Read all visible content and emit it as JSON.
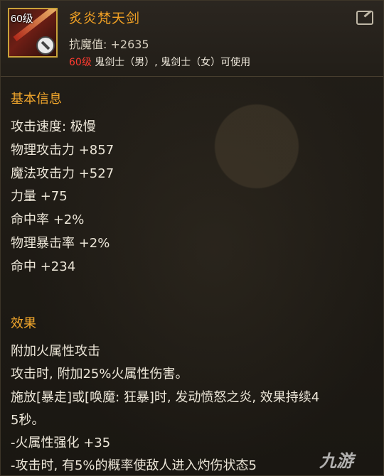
{
  "item": {
    "level_badge": "60级",
    "name": "炙炎梵天剑",
    "resist_label": "抗魔值: +2635",
    "usable_level": "60级",
    "usable_classes": "鬼剑士（男）, 鬼剑士（女）可使用"
  },
  "basic": {
    "title": "基本信息",
    "lines": [
      "攻击速度: 极慢",
      "物理攻击力 +857",
      "魔法攻击力 +527",
      "力量 +75",
      "命中率 +2%",
      "物理暴击率 +2%",
      "命中 +234"
    ]
  },
  "effect": {
    "title": "效果",
    "lines": [
      "附加火属性攻击",
      "攻击时, 附加25%火属性伤害。",
      "施放[暴走]或[唤魔: 狂暴]时, 发动愤怒之炎, 效果持续4",
      "5秒。",
      "-火属性强化 +35",
      "-攻击时, 有5%的概率使敌人进入灼伤状态5"
    ]
  },
  "watermark": "九游",
  "icons": {
    "share": "share-icon",
    "forbidden": "no-entry-icon"
  },
  "colors": {
    "name": "#f0a024",
    "section": "#f2a72c",
    "level_red": "#ff3b30"
  }
}
